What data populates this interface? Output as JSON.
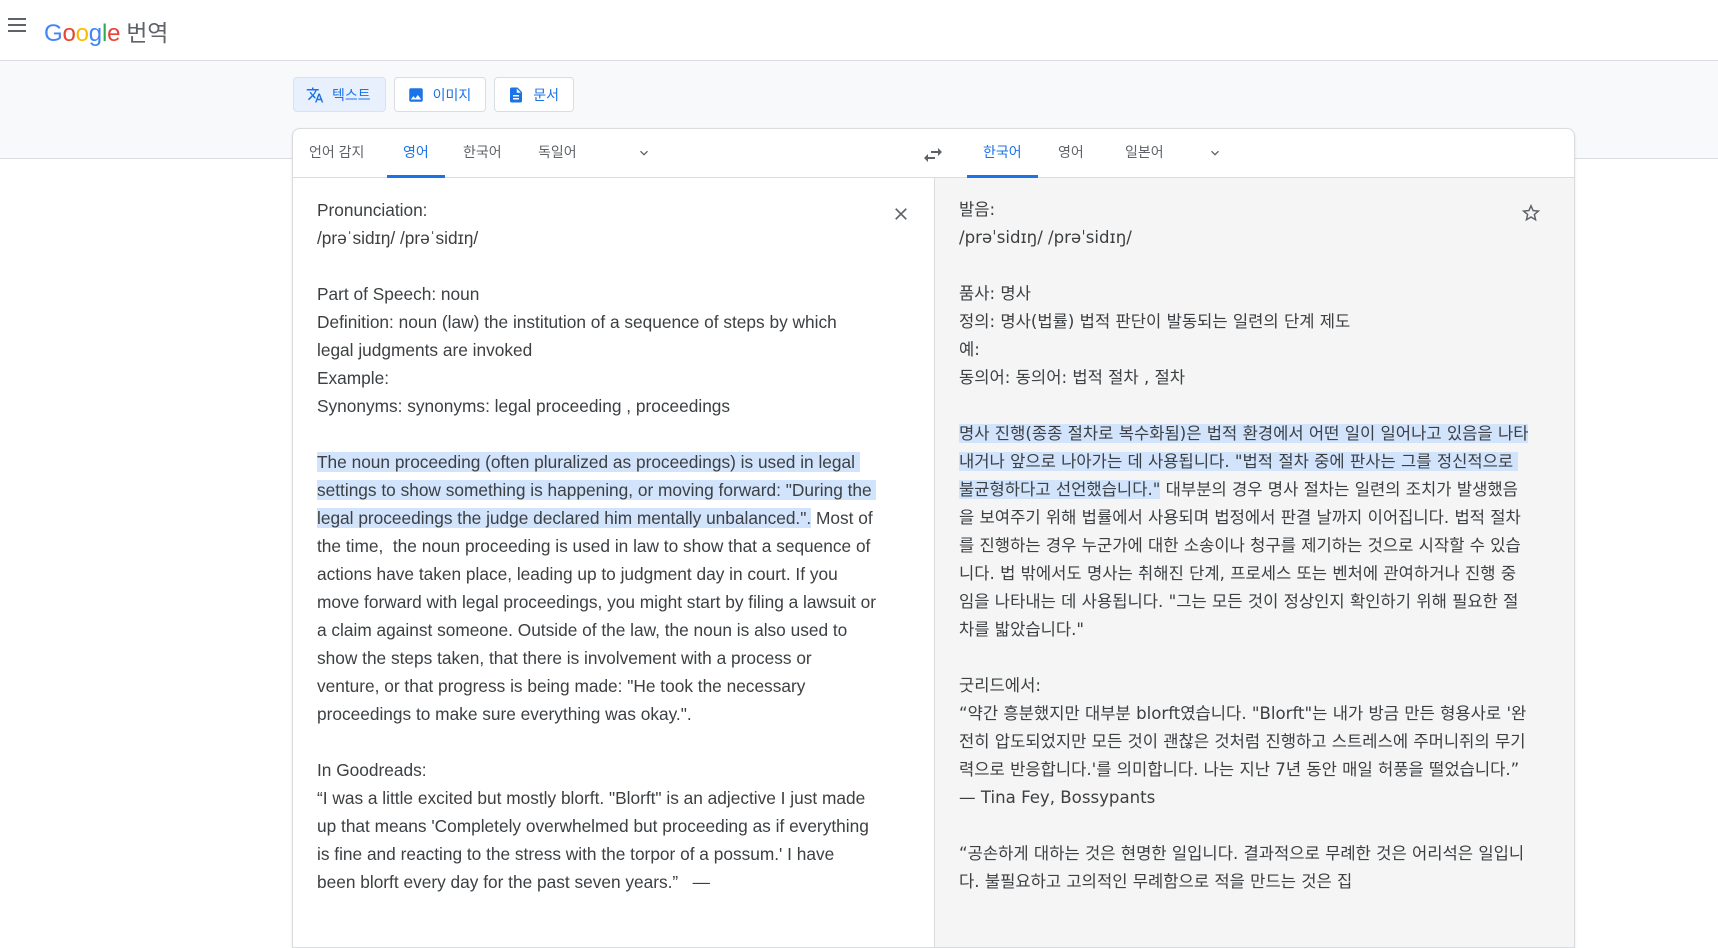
{
  "header": {
    "logo": {
      "G": "G",
      "o1": "o",
      "o2": "o",
      "g": "g",
      "l": "l",
      "e": "e"
    },
    "product": "번역"
  },
  "modes": [
    {
      "label": "텍스트",
      "icon": "translate-icon"
    },
    {
      "label": "이미지",
      "icon": "image-icon"
    },
    {
      "label": "문서",
      "icon": "document-icon"
    }
  ],
  "source_langs": [
    "언어 감지",
    "영어",
    "한국어",
    "독일어"
  ],
  "target_langs": [
    "한국어",
    "영어",
    "일본어"
  ],
  "source": {
    "para1": "Pronunciation:\n/prəˈsidɪŋ/ /prəˈsidɪŋ/\n\nPart of Speech: noun\nDefinition: noun (law) the institution of a sequence of steps by which legal judgments are invoked\nExample:\nSynonyms: synonyms: legal proceeding , proceedings\n\n",
    "highlight": "The noun proceeding (often pluralized as proceedings) is used in legal settings to show something is happening, or moving forward: \"During the legal proceedings the judge declared him mentally unbalanced.\".",
    "para2": " Most of the time,  the noun proceeding is used in law to show that a sequence of actions have taken place, leading up to judgment day in court. If you move forward with legal proceedings, you might start by filing a lawsuit or a claim against someone. Outside of the law, the noun is also used to show the steps taken, that there is involvement with a process or venture, or that progress is being made: \"He took the necessary proceedings to make sure everything was okay.\".\n\nIn Goodreads:\n“I was a little excited but mostly blorft. \"Blorft\" is an adjective I just made up that means 'Completely overwhelmed but proceeding as if everything is fine and reacting to the stress with the torpor of a possum.' I have been blorft every day for the past seven years.”   —"
  },
  "target": {
    "para1": "발음:\n/prəˈsidɪŋ/ /prəˈsidɪŋ/\n\n품사: 명사\n정의: 명사(법률) 법적 판단이 발동되는 일련의 단계 제도\n예:\n동의어: 동의어: 법적 절차 , 절차\n\n",
    "highlight": "명사 진행(종종 절차로 복수화됨)은 법적 환경에서 어떤 일이 일어나고 있음을 나타내거나 앞으로 나아가는 데 사용됩니다. \"법적 절차 중에 판사는 그를 정신적으로 불균형하다고 선언했습니다.\"",
    "para2": " 대부분의 경우 명사 절차는 일련의 조치가 발생했음을 보여주기 위해 법률에서 사용되며 법정에서 판결 날까지 이어집니다. 법적 절차를 진행하는 경우 누군가에 대한 소송이나 청구를 제기하는 것으로 시작할 수 있습니다. 법 밖에서도 명사는 취해진 단계, 프로세스 또는 벤처에 관여하거나 진행 중임을 나타내는 데 사용됩니다. \"그는 모든 것이 정상인지 확인하기 위해 필요한 절차를 밟았습니다.\"\n\n굿리드에서:\n“약간 흥분했지만 대부분 blorft였습니다. \"Blorft\"는 내가 방금 만든 형용사로 '완전히 압도되었지만 모든 것이 괜찮은 것처럼 진행하고 스트레스에 주머니쥐의 무기력으로 반응합니다.'를 의미합니다. 나는 지난 7년 동안 매일 허풍을 떨었습니다.” — Tina Fey, Bossypants\n\n“공손하게 대하는 것은 현명한 일입니다. 결과적으로 무례한 것은 어리석은 일입니다. 불필요하고 고의적인 무례함으로 적을 만드는 것은 집"
  },
  "colors": {
    "accent": "#1a73e8",
    "highlight": "#d2e3fc",
    "target_bg": "#f5f5f5"
  }
}
